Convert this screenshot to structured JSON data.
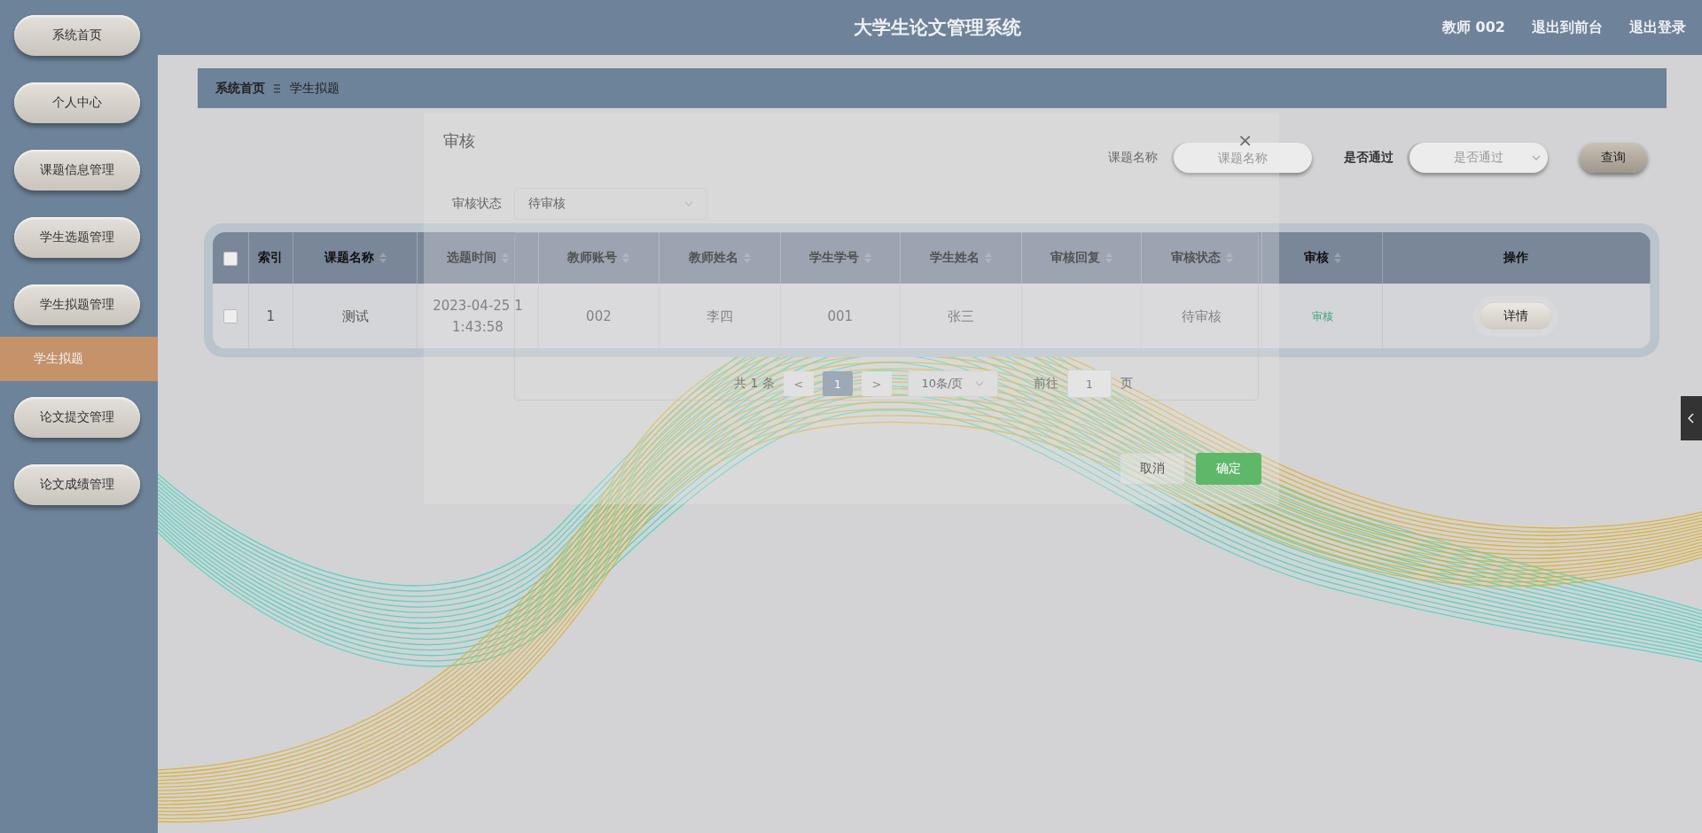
{
  "header": {
    "title": "大学生论文管理系统",
    "user": "教师 002",
    "links": [
      "退出到前台",
      "退出登录"
    ]
  },
  "sidebar": {
    "items": [
      {
        "label": "系统首页",
        "kind": "menu",
        "selected": false
      },
      {
        "label": "个人中心",
        "kind": "menu",
        "selected": false
      },
      {
        "label": "课题信息管理",
        "kind": "menu",
        "selected": false
      },
      {
        "label": "学生选题管理",
        "kind": "menu",
        "selected": false
      },
      {
        "label": "学生拟题管理",
        "kind": "menu",
        "selected": false
      },
      {
        "label": "学生拟题",
        "kind": "submenu",
        "selected": true
      },
      {
        "label": "论文提交管理",
        "kind": "menu",
        "selected": false
      },
      {
        "label": "论文成绩管理",
        "kind": "menu",
        "selected": false
      }
    ]
  },
  "breadcrumb": [
    "系统首页",
    "学生拟题"
  ],
  "search": {
    "fields": [
      {
        "label": "课题名称",
        "placeholder": "课题名称",
        "kind": "input"
      },
      {
        "label": "是否通过",
        "placeholder": "是否通过",
        "kind": "select"
      }
    ],
    "button": "查询"
  },
  "table": {
    "all_checked": false,
    "columns": [
      {
        "label": "索引",
        "sortable": false
      },
      {
        "label": "课题名称",
        "sortable": true
      },
      {
        "label": "选题时间",
        "sortable": true
      },
      {
        "label": "教师账号",
        "sortable": true
      },
      {
        "label": "教师姓名",
        "sortable": true
      },
      {
        "label": "学生学号",
        "sortable": true
      },
      {
        "label": "学生姓名",
        "sortable": true
      },
      {
        "label": "审核回复",
        "sortable": true
      },
      {
        "label": "审核状态",
        "sortable": true
      },
      {
        "label": "审核",
        "sortable": true
      },
      {
        "label": "操作",
        "sortable": false
      }
    ],
    "rows": [
      {
        "checked": false,
        "cells": [
          {
            "kind": "text",
            "text": "1"
          },
          {
            "kind": "text",
            "text": "测试"
          },
          {
            "kind": "text",
            "text": "2023-04-25 11:43:58"
          },
          {
            "kind": "text",
            "text": "002"
          },
          {
            "kind": "text",
            "text": "李四"
          },
          {
            "kind": "text",
            "text": "001"
          },
          {
            "kind": "text",
            "text": "张三"
          },
          {
            "kind": "blank"
          },
          {
            "kind": "text",
            "text": "待审核"
          },
          {
            "kind": "link",
            "text": "审核"
          },
          {
            "kind": "button",
            "text": "详情"
          }
        ]
      }
    ]
  },
  "pagination": {
    "total": "共 1 条",
    "prev": "<",
    "pages": [
      {
        "label": "1",
        "selected": true
      }
    ],
    "next": ">",
    "page_size": "10条/页",
    "goto_label": "前往",
    "goto_value": "1",
    "goto_suffix": "页"
  },
  "dialog": {
    "title": "审核",
    "close": "×",
    "field": {
      "label": "审核状态",
      "value": "待审核"
    },
    "buttons": [
      {
        "label": "取消",
        "kind": "default"
      },
      {
        "label": "确定",
        "kind": "primary"
      }
    ]
  }
}
